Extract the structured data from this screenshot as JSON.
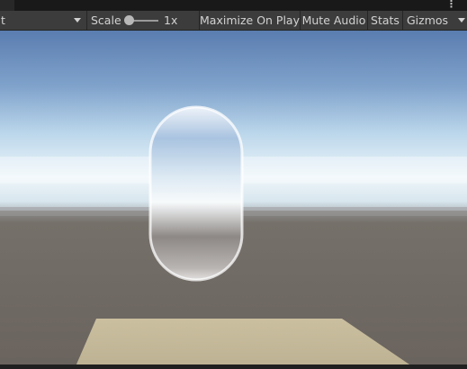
{
  "toolbar": {
    "aspect_label": "t",
    "scale_label": "Scale",
    "scale_value": "1x",
    "maximize_label": "Maximize On Play",
    "mute_label": "Mute Audio",
    "stats_label": "Stats",
    "gizmos_label": "Gizmos"
  },
  "scale_slider": {
    "value": 0.0
  },
  "icons": {
    "menu": "vertical-ellipsis-icon",
    "aspect_dropdown": "chevron-down-icon",
    "gizmos_dropdown": "chevron-down-icon"
  },
  "scene": {
    "sky_top_color": "#5b7fb0",
    "horizon_color": "#e8f2f8",
    "ground_color": "#6b645f",
    "plane_color": "#c3b898",
    "capsule_color": "#ffffff"
  }
}
